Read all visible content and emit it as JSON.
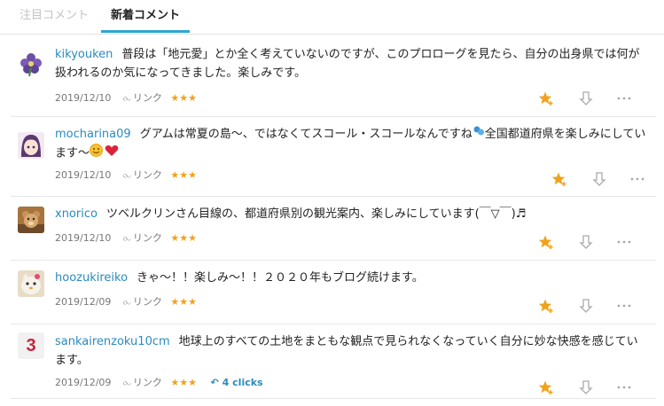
{
  "tabs": {
    "featured": "注目コメント",
    "latest": "新着コメント"
  },
  "colors": {
    "accent": "#2ca6d3",
    "username": "#2a8bbd",
    "star": "#f0a21a"
  },
  "comments": [
    {
      "user": "kikyouken",
      "text": "普段は「地元愛」とか全く考えていないのですが、このプロローグを見たら、自分の出身県では何が扱われるのか気になってきました。楽しみです。",
      "date": "2019/12/10",
      "link_label": "リンク",
      "stars": "★★★",
      "avatar": "flower-avatar"
    },
    {
      "user": "mocharina09",
      "text_before": "グアムは常夏の島〜、ではなくてスコール・スコールなんですね",
      "text_mid": "全国都道府県を楽しみにしています〜",
      "date": "2019/12/10",
      "link_label": "リンク",
      "stars": "★★★",
      "avatar": "anime-girl-avatar"
    },
    {
      "user": "xnorico",
      "text": "ツベルクリンさん目線の、都道府県別の観光案内、楽しみにしています(￣▽￣)♬",
      "date": "2019/12/10",
      "link_label": "リンク",
      "stars": "★★★",
      "avatar": "teddy-bear-avatar"
    },
    {
      "user": "hoozukireiko",
      "text": "きゃ〜！！楽しみ〜！！２０２０年もブログ続けます。",
      "date": "2019/12/09",
      "link_label": "リンク",
      "stars": "★★★",
      "avatar": "cat-avatar"
    },
    {
      "user": "sankairenzoku10cm",
      "text": "地球上のすべての土地をまともな観点で見られなくなっていく自分に妙な快感を感じています。",
      "date": "2019/12/09",
      "link_label": "リンク",
      "stars": "★★★",
      "clicks": "4 clicks",
      "avatar_text": "3"
    }
  ]
}
